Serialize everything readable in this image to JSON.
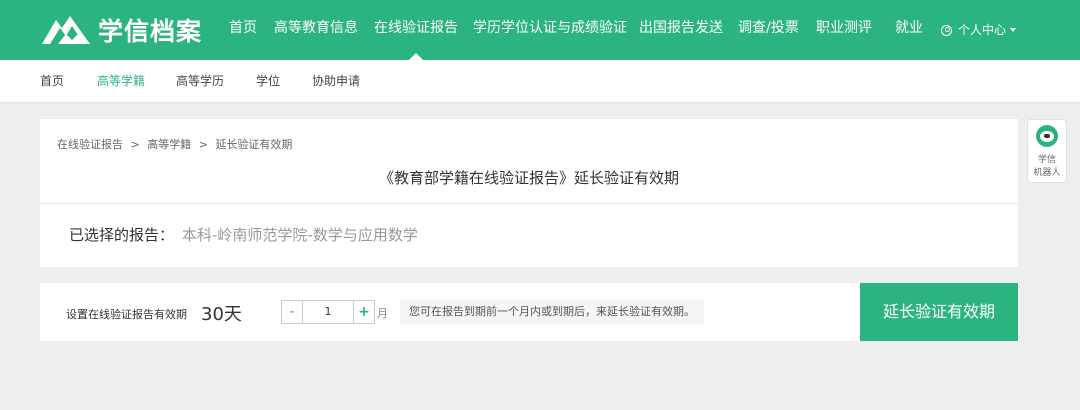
{
  "header": {
    "logo_text": "学信档案",
    "nav": [
      "首页",
      "高等教育信息",
      "在线验证报告",
      "学历学位认证与成绩验证",
      "出国报告发送",
      "调查/投票",
      "职业测评",
      "就业"
    ],
    "active_nav": "在线验证报告",
    "user_menu_label": "个人中心"
  },
  "subnav": {
    "items": [
      "首页",
      "高等学籍",
      "高等学历",
      "学位",
      "协助申请"
    ],
    "active": "高等学籍"
  },
  "breadcrumb": [
    "在线验证报告",
    ">",
    "高等学籍",
    ">",
    "延长验证有效期"
  ],
  "card": {
    "title": "《教育部学籍在线验证报告》延长验证有效期",
    "selected_label": "已选择的报告：",
    "selected_value": "本科-岭南师范学院-数学与应用数学"
  },
  "validity": {
    "label": "设置在线验证报告有效期",
    "days": "30天",
    "minus": "-",
    "plus": "+",
    "value": "1",
    "unit": "月",
    "hint": "您可在报告到期前一个月内或到期后，来延长验证有效期。",
    "button": "延长验证有效期"
  },
  "robot": {
    "label_line1": "学信",
    "label_line2": "机器人"
  },
  "colors": {
    "brand": "#2bb480",
    "background": "#eeeeee"
  }
}
